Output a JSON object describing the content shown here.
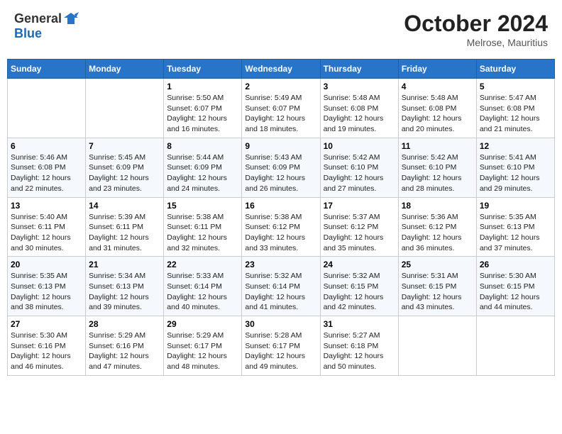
{
  "header": {
    "logo_general": "General",
    "logo_blue": "Blue",
    "month_year": "October 2024",
    "location": "Melrose, Mauritius"
  },
  "days_of_week": [
    "Sunday",
    "Monday",
    "Tuesday",
    "Wednesday",
    "Thursday",
    "Friday",
    "Saturday"
  ],
  "weeks": [
    [
      {
        "day": "",
        "sunrise": "",
        "sunset": "",
        "daylight": ""
      },
      {
        "day": "",
        "sunrise": "",
        "sunset": "",
        "daylight": ""
      },
      {
        "day": "1",
        "sunrise": "Sunrise: 5:50 AM",
        "sunset": "Sunset: 6:07 PM",
        "daylight": "Daylight: 12 hours and 16 minutes."
      },
      {
        "day": "2",
        "sunrise": "Sunrise: 5:49 AM",
        "sunset": "Sunset: 6:07 PM",
        "daylight": "Daylight: 12 hours and 18 minutes."
      },
      {
        "day": "3",
        "sunrise": "Sunrise: 5:48 AM",
        "sunset": "Sunset: 6:08 PM",
        "daylight": "Daylight: 12 hours and 19 minutes."
      },
      {
        "day": "4",
        "sunrise": "Sunrise: 5:48 AM",
        "sunset": "Sunset: 6:08 PM",
        "daylight": "Daylight: 12 hours and 20 minutes."
      },
      {
        "day": "5",
        "sunrise": "Sunrise: 5:47 AM",
        "sunset": "Sunset: 6:08 PM",
        "daylight": "Daylight: 12 hours and 21 minutes."
      }
    ],
    [
      {
        "day": "6",
        "sunrise": "Sunrise: 5:46 AM",
        "sunset": "Sunset: 6:08 PM",
        "daylight": "Daylight: 12 hours and 22 minutes."
      },
      {
        "day": "7",
        "sunrise": "Sunrise: 5:45 AM",
        "sunset": "Sunset: 6:09 PM",
        "daylight": "Daylight: 12 hours and 23 minutes."
      },
      {
        "day": "8",
        "sunrise": "Sunrise: 5:44 AM",
        "sunset": "Sunset: 6:09 PM",
        "daylight": "Daylight: 12 hours and 24 minutes."
      },
      {
        "day": "9",
        "sunrise": "Sunrise: 5:43 AM",
        "sunset": "Sunset: 6:09 PM",
        "daylight": "Daylight: 12 hours and 26 minutes."
      },
      {
        "day": "10",
        "sunrise": "Sunrise: 5:42 AM",
        "sunset": "Sunset: 6:10 PM",
        "daylight": "Daylight: 12 hours and 27 minutes."
      },
      {
        "day": "11",
        "sunrise": "Sunrise: 5:42 AM",
        "sunset": "Sunset: 6:10 PM",
        "daylight": "Daylight: 12 hours and 28 minutes."
      },
      {
        "day": "12",
        "sunrise": "Sunrise: 5:41 AM",
        "sunset": "Sunset: 6:10 PM",
        "daylight": "Daylight: 12 hours and 29 minutes."
      }
    ],
    [
      {
        "day": "13",
        "sunrise": "Sunrise: 5:40 AM",
        "sunset": "Sunset: 6:11 PM",
        "daylight": "Daylight: 12 hours and 30 minutes."
      },
      {
        "day": "14",
        "sunrise": "Sunrise: 5:39 AM",
        "sunset": "Sunset: 6:11 PM",
        "daylight": "Daylight: 12 hours and 31 minutes."
      },
      {
        "day": "15",
        "sunrise": "Sunrise: 5:38 AM",
        "sunset": "Sunset: 6:11 PM",
        "daylight": "Daylight: 12 hours and 32 minutes."
      },
      {
        "day": "16",
        "sunrise": "Sunrise: 5:38 AM",
        "sunset": "Sunset: 6:12 PM",
        "daylight": "Daylight: 12 hours and 33 minutes."
      },
      {
        "day": "17",
        "sunrise": "Sunrise: 5:37 AM",
        "sunset": "Sunset: 6:12 PM",
        "daylight": "Daylight: 12 hours and 35 minutes."
      },
      {
        "day": "18",
        "sunrise": "Sunrise: 5:36 AM",
        "sunset": "Sunset: 6:12 PM",
        "daylight": "Daylight: 12 hours and 36 minutes."
      },
      {
        "day": "19",
        "sunrise": "Sunrise: 5:35 AM",
        "sunset": "Sunset: 6:13 PM",
        "daylight": "Daylight: 12 hours and 37 minutes."
      }
    ],
    [
      {
        "day": "20",
        "sunrise": "Sunrise: 5:35 AM",
        "sunset": "Sunset: 6:13 PM",
        "daylight": "Daylight: 12 hours and 38 minutes."
      },
      {
        "day": "21",
        "sunrise": "Sunrise: 5:34 AM",
        "sunset": "Sunset: 6:13 PM",
        "daylight": "Daylight: 12 hours and 39 minutes."
      },
      {
        "day": "22",
        "sunrise": "Sunrise: 5:33 AM",
        "sunset": "Sunset: 6:14 PM",
        "daylight": "Daylight: 12 hours and 40 minutes."
      },
      {
        "day": "23",
        "sunrise": "Sunrise: 5:32 AM",
        "sunset": "Sunset: 6:14 PM",
        "daylight": "Daylight: 12 hours and 41 minutes."
      },
      {
        "day": "24",
        "sunrise": "Sunrise: 5:32 AM",
        "sunset": "Sunset: 6:15 PM",
        "daylight": "Daylight: 12 hours and 42 minutes."
      },
      {
        "day": "25",
        "sunrise": "Sunrise: 5:31 AM",
        "sunset": "Sunset: 6:15 PM",
        "daylight": "Daylight: 12 hours and 43 minutes."
      },
      {
        "day": "26",
        "sunrise": "Sunrise: 5:30 AM",
        "sunset": "Sunset: 6:15 PM",
        "daylight": "Daylight: 12 hours and 44 minutes."
      }
    ],
    [
      {
        "day": "27",
        "sunrise": "Sunrise: 5:30 AM",
        "sunset": "Sunset: 6:16 PM",
        "daylight": "Daylight: 12 hours and 46 minutes."
      },
      {
        "day": "28",
        "sunrise": "Sunrise: 5:29 AM",
        "sunset": "Sunset: 6:16 PM",
        "daylight": "Daylight: 12 hours and 47 minutes."
      },
      {
        "day": "29",
        "sunrise": "Sunrise: 5:29 AM",
        "sunset": "Sunset: 6:17 PM",
        "daylight": "Daylight: 12 hours and 48 minutes."
      },
      {
        "day": "30",
        "sunrise": "Sunrise: 5:28 AM",
        "sunset": "Sunset: 6:17 PM",
        "daylight": "Daylight: 12 hours and 49 minutes."
      },
      {
        "day": "31",
        "sunrise": "Sunrise: 5:27 AM",
        "sunset": "Sunset: 6:18 PM",
        "daylight": "Daylight: 12 hours and 50 minutes."
      },
      {
        "day": "",
        "sunrise": "",
        "sunset": "",
        "daylight": ""
      },
      {
        "day": "",
        "sunrise": "",
        "sunset": "",
        "daylight": ""
      }
    ]
  ]
}
